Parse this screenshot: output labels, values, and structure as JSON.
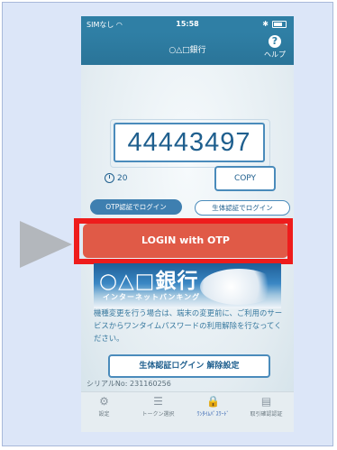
{
  "status_bar": {
    "carrier": "SIMなし",
    "time": "15:58",
    "bluetooth": "✱"
  },
  "nav": {
    "title": "○△□銀行",
    "help_label": "ヘルプ"
  },
  "otp": {
    "code": "44443497",
    "seconds_remaining": "20",
    "copy_label": "COPY"
  },
  "mode_tabs": {
    "otp": "OTP認証でログイン",
    "biometric": "生体認証でログイン"
  },
  "login_label": "LOGIN with OTP",
  "banner": {
    "title": "○△□銀行",
    "subtitle": "インターネットバンキング"
  },
  "notice": "機種変更を行う場合は、端末の変更前に、ご利用のサービスからワンタイムパスワードの利用解除を行なってください。",
  "bio_settings_label": "生体認証ログイン 解除設定",
  "serial": "シリアルNo: 231160256",
  "tabs": [
    {
      "label": "設定",
      "icon": "gear-icon"
    },
    {
      "label": "トークン選択",
      "icon": "list-icon"
    },
    {
      "label": "ﾜﾝﾀｲﾑﾊﾟｽﾜｰﾄﾞ",
      "icon": "lock-icon"
    },
    {
      "label": "取引確認認証",
      "icon": "document-icon"
    }
  ],
  "colors": {
    "nav": "#2f7fa5",
    "login": "#e05a47",
    "highlight": "#ee1c1c",
    "accent": "#4a8bbb"
  }
}
